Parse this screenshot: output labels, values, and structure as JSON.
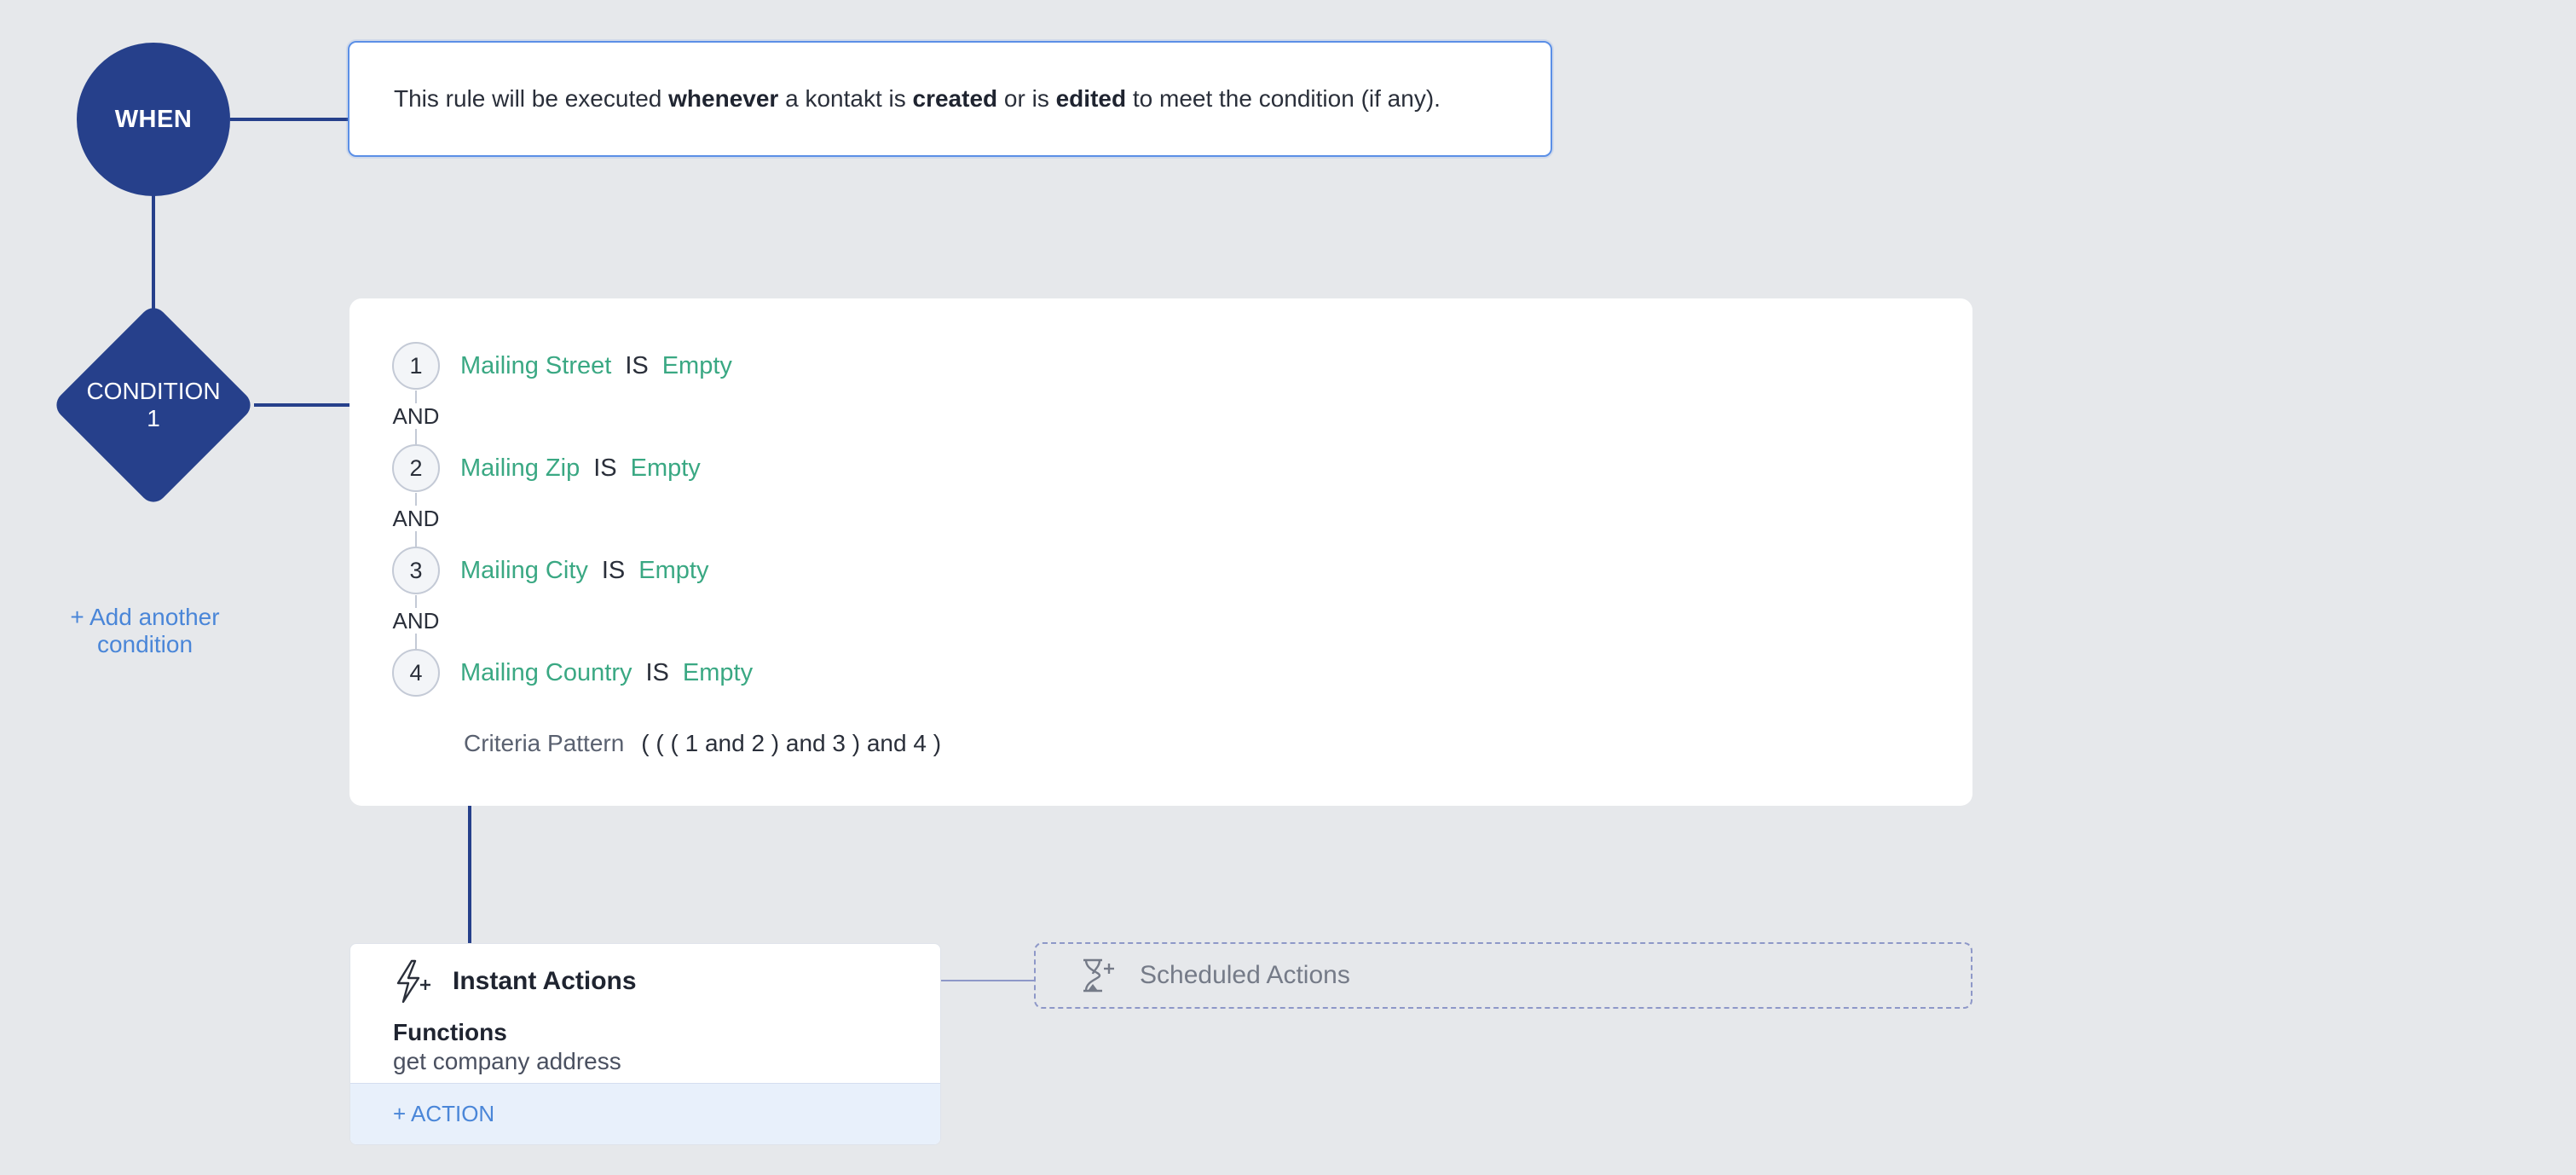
{
  "when": {
    "node_label": "WHEN",
    "description": {
      "p1": "This rule will be executed ",
      "b1": "whenever",
      "p2": " a kontakt is ",
      "b2": "created",
      "p3": " or is ",
      "b3": "edited",
      "p4": " to meet the condition (if any)."
    }
  },
  "condition": {
    "node_label_line1": "CONDITION",
    "node_label_line2": "1",
    "add_another": "+ Add another condition",
    "criteria": [
      {
        "num": "1",
        "field": "Mailing Street",
        "op": "IS",
        "value": "Empty"
      },
      {
        "num": "2",
        "field": "Mailing Zip",
        "op": "IS",
        "value": "Empty"
      },
      {
        "num": "3",
        "field": "Mailing City",
        "op": "IS",
        "value": "Empty"
      },
      {
        "num": "4",
        "field": "Mailing Country",
        "op": "IS",
        "value": "Empty"
      }
    ],
    "and_label": "AND",
    "pattern_label": "Criteria Pattern",
    "pattern_value": "( ( ( 1 and 2 ) and 3 ) and 4 )"
  },
  "instant_actions": {
    "title": "Instant Actions",
    "icon": "lightning-plus-icon",
    "function_heading": "Functions",
    "function_value": "get company address",
    "add_action": "+ ACTION"
  },
  "scheduled_actions": {
    "title": "Scheduled Actions",
    "icon": "hourglass-plus-icon"
  },
  "colors": {
    "node": "#26408b",
    "field": "#3aa883",
    "link": "#4a86d8",
    "background": "#e6e8eb"
  }
}
